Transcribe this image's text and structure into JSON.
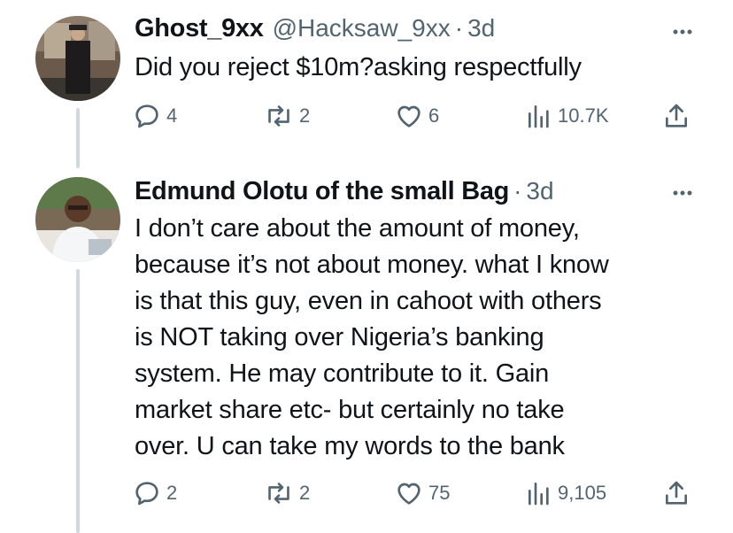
{
  "tweets": [
    {
      "author_name": "Ghost_9xx",
      "handle": "@Hacksaw_9xx",
      "separator": "·",
      "time": "3d",
      "text_lines": [
        "Did you reject $10m?asking respectfully"
      ],
      "stats": {
        "replies": "4",
        "reposts": "2",
        "likes": "6",
        "views": "10.7K"
      },
      "icons": [
        "reply-icon",
        "repost-icon",
        "like-icon",
        "views-icon",
        "share-icon",
        "more-icon"
      ]
    },
    {
      "author_name": "Edmund Olotu of the small Bag",
      "handle": "",
      "separator": "·",
      "time": "3d",
      "text_lines": [
        "I don’t care about the amount of money,",
        "because it’s not about money. what I know",
        "is that this guy, even in cahoot with others",
        "is NOT taking over Nigeria’s banking",
        "system. He may contribute to it. Gain",
        "market share etc- but certainly no take",
        "over. U can take my words to the bank"
      ],
      "stats": {
        "replies": "2",
        "reposts": "2",
        "likes": "75",
        "views": "9,105"
      },
      "icons": [
        "reply-icon",
        "repost-icon",
        "like-icon",
        "views-icon",
        "share-icon",
        "more-icon"
      ]
    }
  ],
  "colors": {
    "text": "#0f1419",
    "secondary": "#536471",
    "thread_line": "#cfd9de"
  }
}
